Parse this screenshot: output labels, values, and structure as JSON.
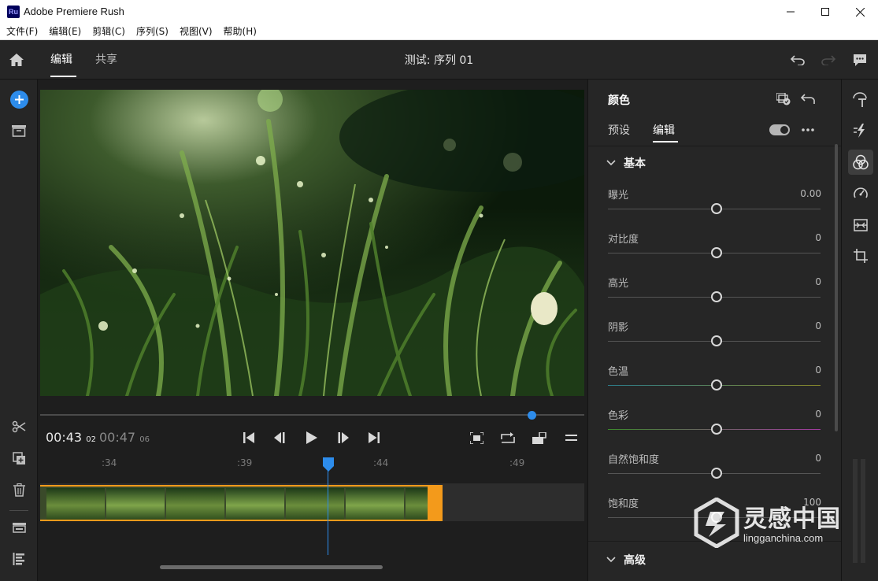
{
  "window": {
    "app_icon": "Ru",
    "title": "Adobe Premiere Rush",
    "controls": [
      "minimize-icon",
      "maximize-icon",
      "close-icon"
    ]
  },
  "menu": [
    "文件(F)",
    "编辑(E)",
    "剪辑(C)",
    "序列(S)",
    "视图(V)",
    "帮助(H)"
  ],
  "topbar": {
    "tabs": [
      {
        "label": "编辑",
        "active": true
      },
      {
        "label": "共享",
        "active": false
      }
    ],
    "project_title": "测试: 序列 01",
    "icons": [
      "home-icon",
      "undo-icon",
      "redo-icon",
      "feedback-icon"
    ]
  },
  "left_rail": {
    "icons": [
      "add-media-icon",
      "project-bin-icon",
      "split-scissors-icon",
      "duplicate-icon",
      "trash-icon",
      "track-settings-icon",
      "timeline-tracks-icon"
    ]
  },
  "player": {
    "current_time": "00:43",
    "current_frames": "02",
    "duration": "00:47",
    "duration_frames": "06",
    "scrub_progress": 0.9,
    "transport_icons": [
      "go-to-start-icon",
      "step-back-icon",
      "play-icon",
      "step-forward-icon",
      "go-to-end-icon"
    ],
    "right_icons": [
      "fullscreen-icon",
      "loop-icon",
      "aspect-ratio-icon",
      "more-lines-icon"
    ]
  },
  "timeline": {
    "ruler_labels": [
      ":34",
      ":39",
      ":44",
      ":49"
    ]
  },
  "color_panel": {
    "title": "颜色",
    "tabs": [
      {
        "label": "预设",
        "active": false
      },
      {
        "label": "编辑",
        "active": true
      }
    ],
    "basic_section": "基本",
    "advanced_section": "高级",
    "sliders": [
      {
        "label": "曝光",
        "value": "0.00",
        "position": 0.5
      },
      {
        "label": "对比度",
        "value": "0",
        "position": 0.5
      },
      {
        "label": "高光",
        "value": "0",
        "position": 0.5
      },
      {
        "label": "阴影",
        "value": "0",
        "position": 0.5
      },
      {
        "label": "色温",
        "value": "0",
        "position": 0.5
      },
      {
        "label": "色彩",
        "value": "0",
        "position": 0.5
      },
      {
        "label": "自然饱和度",
        "value": "0",
        "position": 0.5
      },
      {
        "label": "饱和度",
        "value": "100",
        "position": 0.5
      }
    ]
  },
  "right_rail": {
    "icons": [
      "titles-icon",
      "transitions-icon",
      "color-icon",
      "speed-icon",
      "audio-icon",
      "transform-icon"
    ]
  },
  "watermark": {
    "cn": "灵感中国",
    "en": "lingganchina.com"
  }
}
